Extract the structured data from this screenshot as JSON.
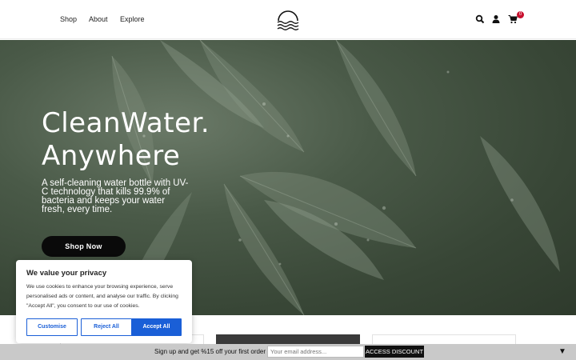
{
  "nav": {
    "shop": "Shop",
    "about": "About",
    "explore": "Explore"
  },
  "header": {
    "cart_count": "0",
    "icons": [
      "search-icon",
      "user-icon",
      "cart-icon"
    ]
  },
  "hero": {
    "title_line1": "CleanWater.",
    "title_line2": "Anywhere",
    "description": "A self-cleaning water bottle with UV-C technology that kills 99.9% of bacteria and keeps your water fresh, every time.",
    "cta": "Shop Now"
  },
  "cookie": {
    "title": "We value your privacy",
    "text": "We use cookies to enhance your browsing experience, serve personalised ads or content, and analyse our traffic. By clicking \"Accept All\", you consent to our use of cookies.",
    "customise": "Customise",
    "reject": "Reject All",
    "accept": "Accept All"
  },
  "signup": {
    "text": "Sign up and get %15 off your first order",
    "placeholder": "Your email address...",
    "button": "ACCESS DISCOUNT",
    "collapse_glyph": "▼"
  },
  "colors": {
    "accent": "#1a5fd7",
    "badge": "#c8102e",
    "cta": "#0a0a0a"
  }
}
